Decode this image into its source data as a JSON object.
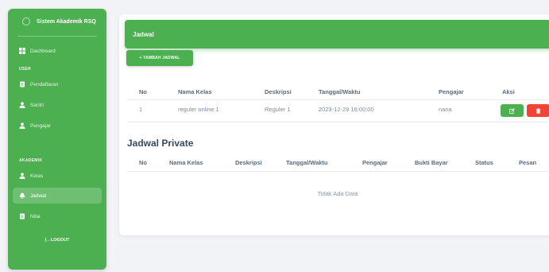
{
  "sidebar": {
    "brand": "Sistem Akademik RSQ",
    "items": [
      {
        "label": "Dashboard",
        "icon": "dashboard-icon"
      },
      {
        "label": "Pendaftaran",
        "icon": "clipboard-icon"
      },
      {
        "label": "Santri",
        "icon": "person-icon"
      },
      {
        "label": "Pengajar",
        "icon": "person-icon"
      },
      {
        "label": "Kelas",
        "icon": "person-icon"
      },
      {
        "label": "Jadwal",
        "icon": "bell-icon"
      },
      {
        "label": "Nilai",
        "icon": "clipboard-icon"
      }
    ],
    "section_user": "USER",
    "section_akademik": "AKADEMIK",
    "logout": "[→LOGOUT"
  },
  "header": {
    "title": "Jadwal"
  },
  "add_button": "+ TAMBAH JADWAL",
  "table1": {
    "columns": [
      "No",
      "Nama Kelas",
      "Deskripsi",
      "Tanggal/Waktu",
      "Pengajar",
      "Aksi"
    ],
    "rows": [
      [
        "1",
        "reguler online 1",
        "Reguler 1",
        "2023-12-29 16:00:00",
        "nana"
      ]
    ]
  },
  "private": {
    "title": "Jadwal Private",
    "columns": [
      "No",
      "Nama Kelas",
      "Deskripsi",
      "Tanggal/Waktu",
      "Pengajar",
      "Bukti Bayar",
      "Status",
      "Pesan"
    ],
    "empty": "Tidak Ada Data"
  },
  "colors": {
    "primary": "#4caf50",
    "danger": "#f44336",
    "background": "#f2f3f6"
  }
}
